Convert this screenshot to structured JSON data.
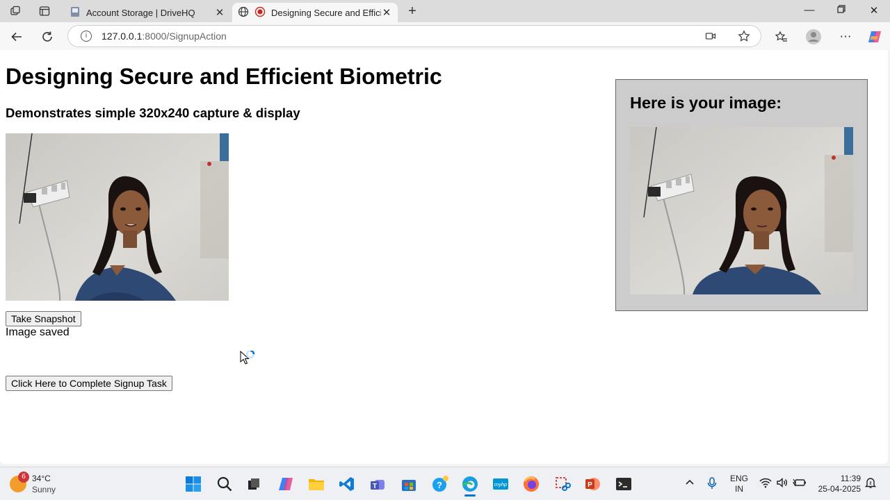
{
  "browser": {
    "tabs": [
      {
        "title": "Account Storage | DriveHQ",
        "icon": "drivehq-icon"
      },
      {
        "title": "Designing Secure and Efficient Biometric",
        "icon": "recording-icon"
      }
    ],
    "url_host": "127.0.0.1",
    "url_path": ":8000/SignupAction"
  },
  "page": {
    "heading": "Designing Secure and Efficient Biometric",
    "subheading": "Demonstrates simple 320x240 capture & display",
    "snapshot_button": "Take Snapshot",
    "status": "Image saved",
    "signup_button": "Click Here to Complete Signup Task",
    "results_heading": "Here is your image:"
  },
  "taskbar": {
    "weather_temp": "34°C",
    "weather_desc": "Sunny",
    "weather_badge": "6",
    "lang_top": "ENG",
    "lang_bottom": "IN",
    "time": "11:39",
    "date": "25-04-2025"
  },
  "colors": {
    "results_bg": "#cccccc",
    "accent": "#0078d4"
  }
}
